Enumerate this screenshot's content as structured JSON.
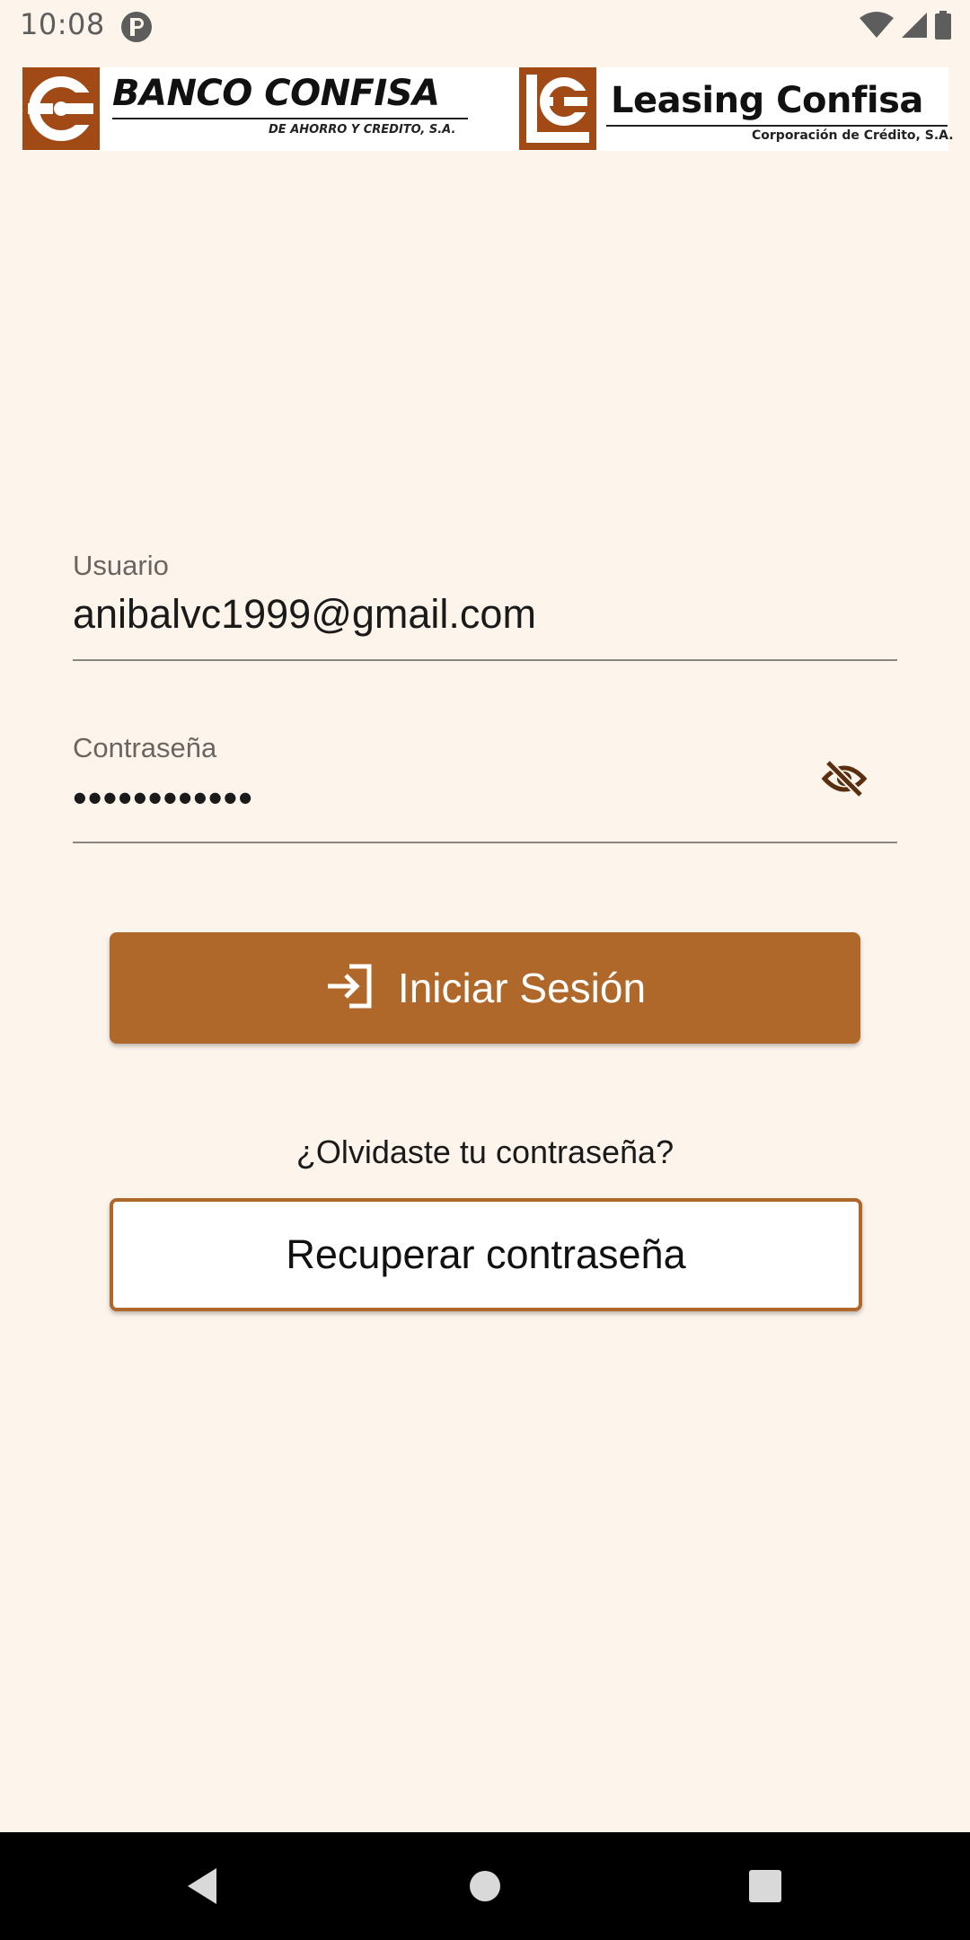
{
  "status_bar": {
    "time": "10:08",
    "icons": [
      "app-notification-icon",
      "wifi-icon",
      "signal-icon",
      "battery-icon"
    ]
  },
  "banner": {
    "left_brand": "BANCO CONFISA",
    "left_subtitle": "DE AHORRO Y CREDITO, S.A.",
    "right_brand": "Leasing Confisa",
    "right_subtitle": "Corporación de Crédito, S.A.",
    "brand_color": "#a24a15"
  },
  "form": {
    "user_label": "Usuario",
    "user_value": "anibalvc1999@gmail.com",
    "password_label": "Contraseña",
    "password_value": "••••••••••••",
    "password_toggle_icon": "eye-off-icon"
  },
  "actions": {
    "login_label": "Iniciar Sesión",
    "login_icon": "login-icon",
    "forgot_text": "¿Olvidaste tu contraseña?",
    "recover_label": "Recuperar contraseña",
    "accent_color": "#b0672a"
  },
  "nav": {
    "back_icon": "back-triangle-icon",
    "home_icon": "home-circle-icon",
    "recents_icon": "recents-square-icon"
  }
}
